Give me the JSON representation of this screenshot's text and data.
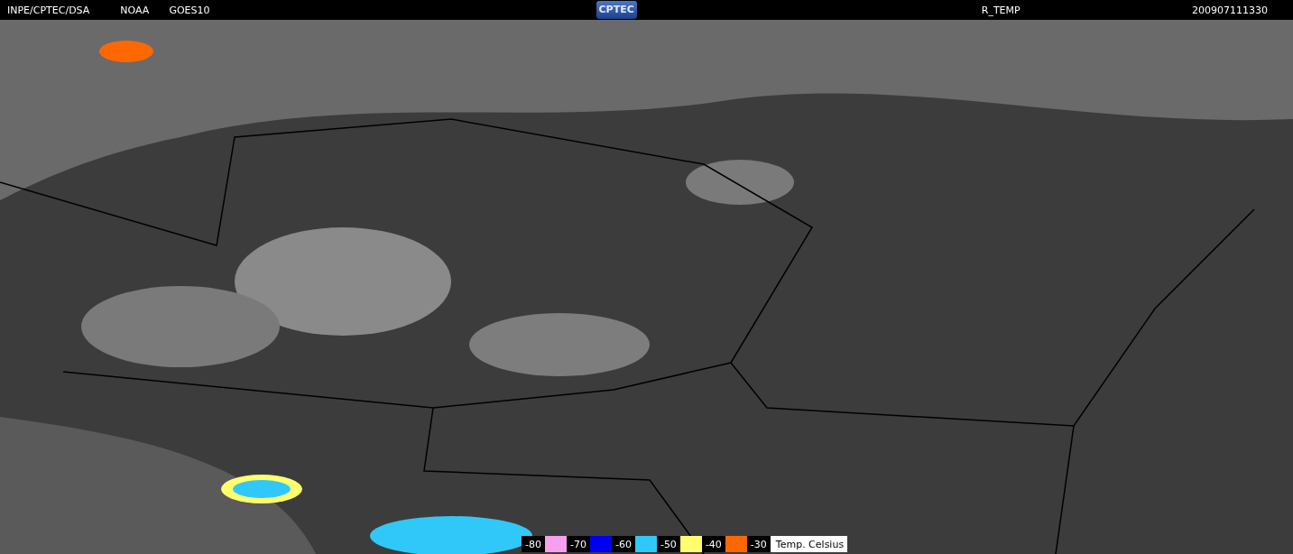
{
  "header": {
    "source": "INPE/CPTEC/DSA",
    "agency": "NOAA",
    "satellite": "GOES10",
    "logo": "CPTEC",
    "product": "R_TEMP",
    "timestamp": "200907111330"
  },
  "legend": {
    "labels": [
      "-80",
      "-70",
      "-60",
      "-50",
      "-40",
      "-30"
    ],
    "swatches": [
      {
        "color": "#f8a0f0"
      },
      {
        "color": "#0000f0"
      },
      {
        "color": "#30c8f8"
      },
      {
        "color": "#ffff70"
      },
      {
        "color": "#ff6800"
      }
    ],
    "unit": "Temp. Celsius"
  }
}
